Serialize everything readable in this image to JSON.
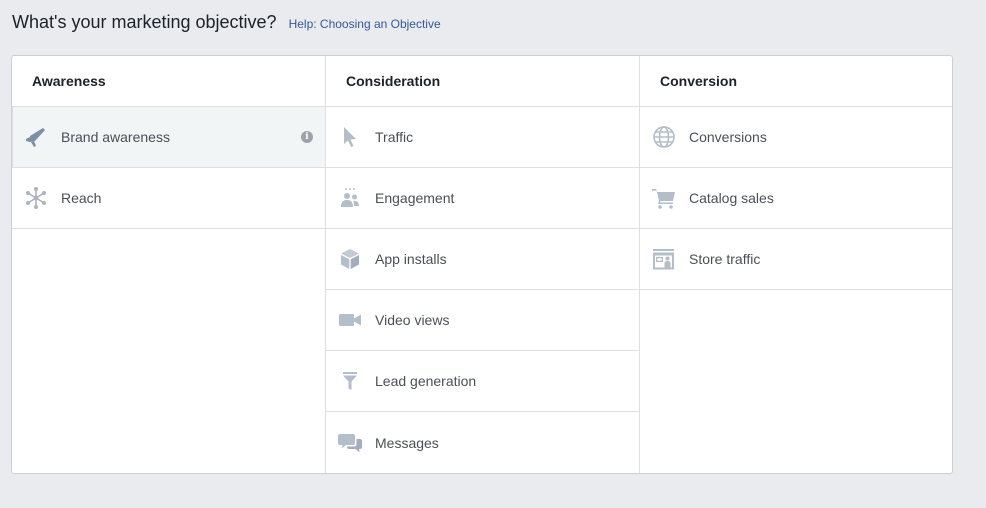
{
  "header": {
    "title": "What's your marketing objective?",
    "help_link": "Help: Choosing an Objective"
  },
  "columns": [
    {
      "title": "Awareness",
      "items": [
        {
          "label": "Brand awareness",
          "icon": "megaphone-icon",
          "selected": true
        },
        {
          "label": "Reach",
          "icon": "reach-network-icon"
        }
      ]
    },
    {
      "title": "Consideration",
      "items": [
        {
          "label": "Traffic",
          "icon": "cursor-icon"
        },
        {
          "label": "Engagement",
          "icon": "people-icon"
        },
        {
          "label": "App installs",
          "icon": "box-icon"
        },
        {
          "label": "Video views",
          "icon": "video-camera-icon"
        },
        {
          "label": "Lead generation",
          "icon": "funnel-icon"
        },
        {
          "label": "Messages",
          "icon": "chat-bubbles-icon"
        }
      ]
    },
    {
      "title": "Conversion",
      "items": [
        {
          "label": "Conversions",
          "icon": "globe-icon"
        },
        {
          "label": "Catalog sales",
          "icon": "shopping-cart-icon"
        },
        {
          "label": "Store traffic",
          "icon": "storefront-icon"
        }
      ]
    }
  ],
  "colors": {
    "icon": "#b4bdca",
    "icon_selected": "#7d8ea7",
    "link": "#365899",
    "background": "#e9ebee"
  }
}
